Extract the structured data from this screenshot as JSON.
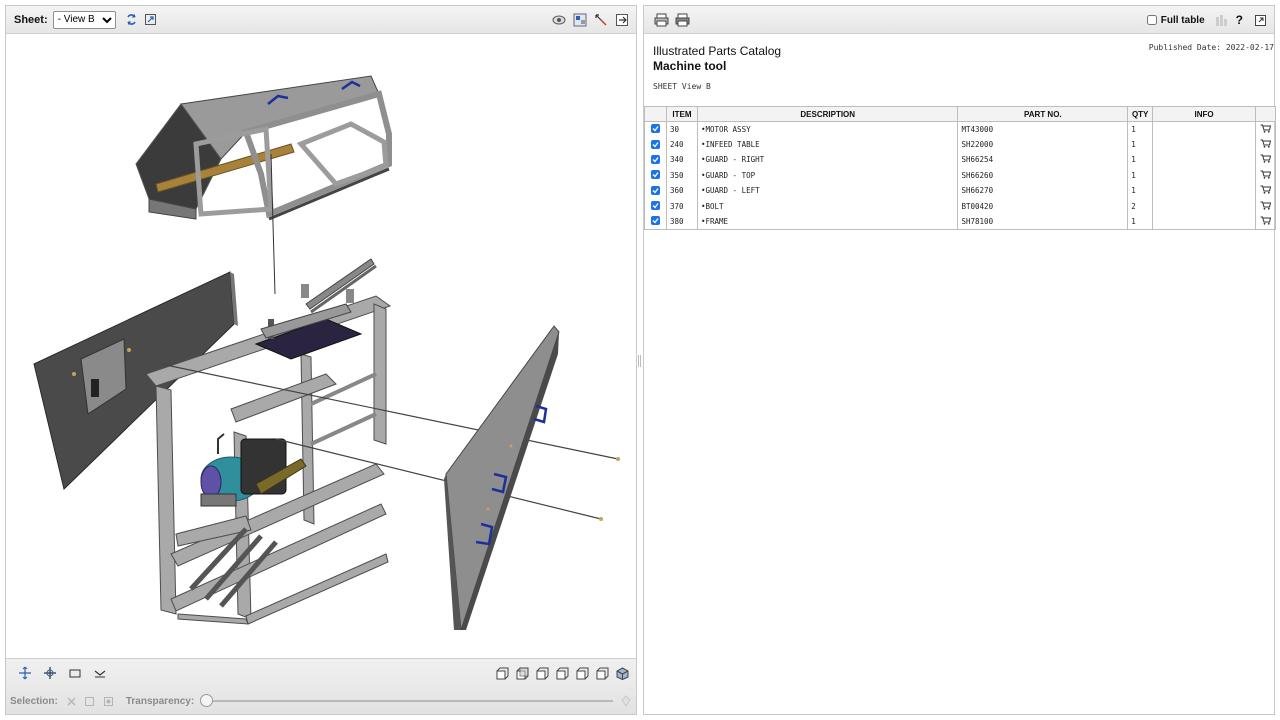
{
  "left_toolbar": {
    "sheet_label": "Sheet:",
    "sheet_value": "- View B",
    "icons": [
      "refresh-icon",
      "fit-view-icon",
      "visibility-icon",
      "highlight-icon",
      "explode-icon",
      "export-icon"
    ]
  },
  "bottom_toolbar": {
    "selection_label": "Selection:",
    "transparency_label": "Transparency:",
    "transparency_value": 0,
    "left_icons": [
      "pan-icon",
      "rotate-icon",
      "zoom-box-icon",
      "zoom-icon"
    ],
    "view_icons": [
      "view-front-icon",
      "view-back-icon",
      "view-left-icon",
      "view-right-icon",
      "view-top-icon",
      "view-bottom-icon",
      "view-iso-icon"
    ]
  },
  "right_toolbar": {
    "full_table_label": "Full table",
    "full_table_checked": false,
    "help_label": "?"
  },
  "document": {
    "title": "Illustrated Parts Catalog",
    "subtitle": "Machine tool",
    "sheet": "SHEET View B",
    "published": "Published Date: 2022-02-17"
  },
  "table": {
    "headers": [
      "ITEM",
      "DESCRIPTION",
      "PART NO.",
      "QTY",
      "INFO"
    ],
    "rows": [
      {
        "item": "30",
        "description": "•MOTOR ASSY",
        "part": "MT43000",
        "qty": "1",
        "info": ""
      },
      {
        "item": "240",
        "description": "•INFEED TABLE",
        "part": "SH22000",
        "qty": "1",
        "info": ""
      },
      {
        "item": "340",
        "description": "•GUARD - RIGHT",
        "part": "SH66254",
        "qty": "1",
        "info": ""
      },
      {
        "item": "350",
        "description": "•GUARD - TOP",
        "part": "SH66260",
        "qty": "1",
        "info": ""
      },
      {
        "item": "360",
        "description": "•GUARD - LEFT",
        "part": "SH66270",
        "qty": "1",
        "info": ""
      },
      {
        "item": "370",
        "description": "•BOLT",
        "part": "BT00420",
        "qty": "2",
        "info": ""
      },
      {
        "item": "380",
        "description": "•FRAME",
        "part": "SH78100",
        "qty": "1",
        "info": ""
      }
    ]
  },
  "colors": {
    "check_blue": "#1b73e8",
    "part_grey": "#8e8e8e",
    "motor_teal": "#2f8f9c",
    "accent_blue": "#1c2f9b"
  }
}
